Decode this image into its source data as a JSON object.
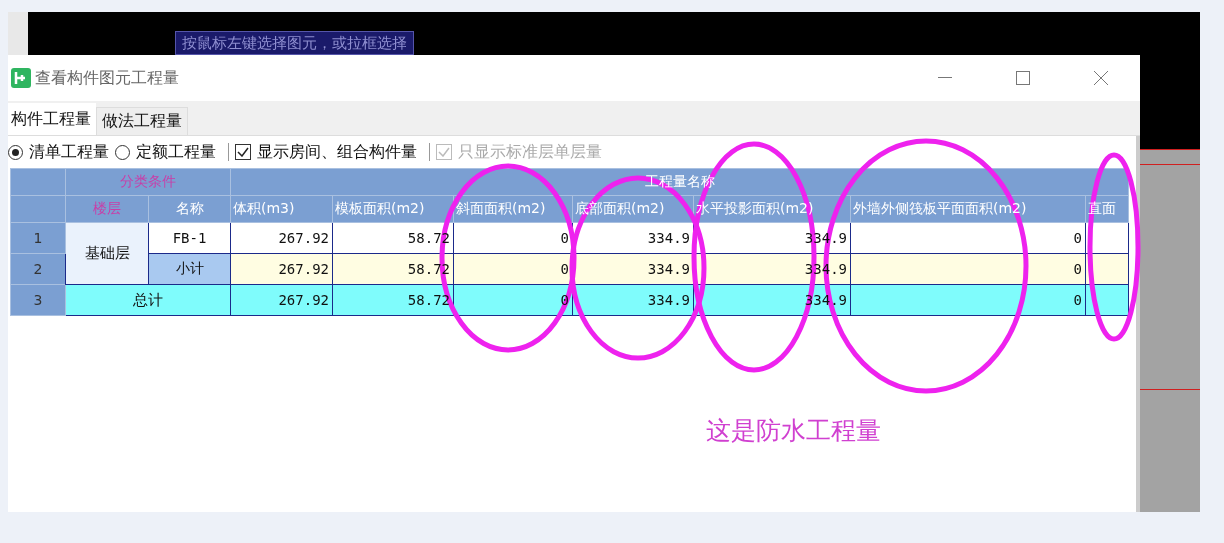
{
  "status_tip": "按鼠标左键选择图元，或拉框选择",
  "window": {
    "title": "查看构件图元工程量"
  },
  "tabs": [
    {
      "label": "构件工程量",
      "selected": true
    },
    {
      "label": "做法工程量",
      "selected": false
    }
  ],
  "options": [
    {
      "kind": "radio",
      "label": "清单工程量",
      "selected": true
    },
    {
      "kind": "radio",
      "label": "定额工程量",
      "selected": false
    },
    {
      "kind": "checkbox",
      "label": "显示房间、组合构件量",
      "checked": true,
      "disabled": false
    },
    {
      "kind": "checkbox",
      "label": "只显示标准层单层量",
      "checked": true,
      "disabled": true
    }
  ],
  "table": {
    "group_headers": [
      "分类条件",
      "工程量名称"
    ],
    "columns": [
      "楼层",
      "名称",
      "体积(m3)",
      "模板面积(m2)",
      "斜面面积(m2)",
      "底部面积(m2)",
      "水平投影面积(m2)",
      "外墙外侧筏板平面面积(m2)",
      "直面"
    ],
    "groups": [
      {
        "floor": "基础层",
        "rows": [
          {
            "index": "1",
            "name": "FB-1",
            "kind": "item",
            "values": [
              "267.92",
              "58.72",
              "0",
              "334.9",
              "334.9",
              "0"
            ]
          },
          {
            "index": "2",
            "name": "小计",
            "kind": "subtotal",
            "values": [
              "267.92",
              "58.72",
              "0",
              "334.9",
              "334.9",
              "0"
            ]
          }
        ]
      }
    ],
    "total": {
      "index": "3",
      "label": "总计",
      "values": [
        "267.92",
        "58.72",
        "0",
        "334.9",
        "334.9",
        "0"
      ]
    }
  },
  "annotation_text": "这是防水工程量"
}
